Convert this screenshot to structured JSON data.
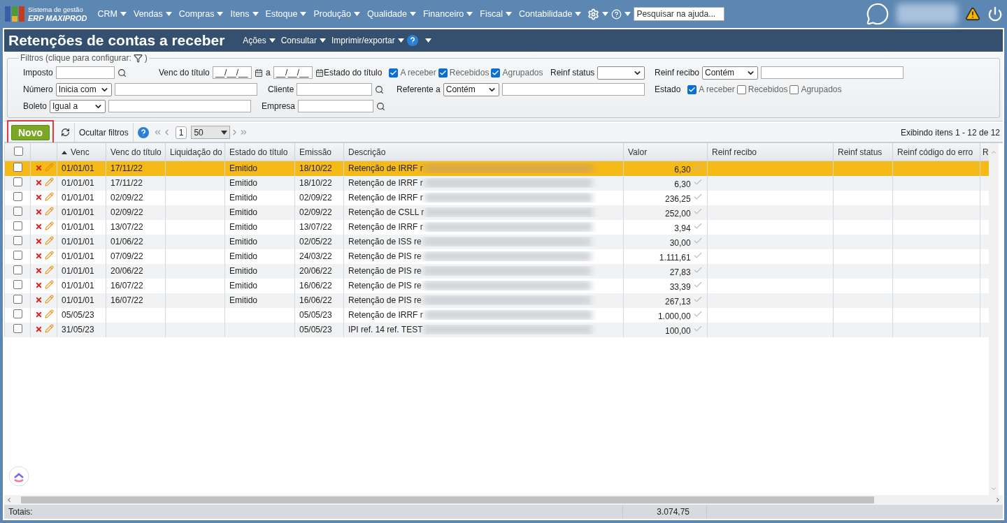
{
  "app": {
    "system_label": "Sistema de gestão",
    "product_name": "ERP MAXIPROD"
  },
  "menu": [
    {
      "label": "CRM"
    },
    {
      "label": "Vendas"
    },
    {
      "label": "Compras"
    },
    {
      "label": "Itens"
    },
    {
      "label": "Estoque"
    },
    {
      "label": "Produção"
    },
    {
      "label": "Qualidade"
    },
    {
      "label": "Financeiro"
    },
    {
      "label": "Fiscal"
    },
    {
      "label": "Contabilidade"
    }
  ],
  "help_search": {
    "placeholder": "Pesquisar na ajuda..."
  },
  "page": {
    "title": "Retenções de contas a receber",
    "actions": [
      {
        "label": "Ações"
      },
      {
        "label": "Consultar"
      },
      {
        "label": "Imprimir/exportar"
      }
    ]
  },
  "filters": {
    "legend": "Filtros (clique para configurar:",
    "legend_end": ")",
    "fields": [
      {
        "kind": "text",
        "label": "Imposto"
      },
      {
        "kind": "date_range",
        "label": "Venc do título",
        "from": "__/__/__",
        "separator": "a",
        "to": "__/__/__"
      },
      {
        "kind": "checks",
        "label": "Estado do título",
        "options": [
          {
            "label": "A receber",
            "checked": true
          },
          {
            "label": "Recebidos",
            "checked": true
          },
          {
            "label": "Agrupados",
            "checked": true
          }
        ]
      },
      {
        "kind": "select",
        "label": "Reinf status"
      },
      {
        "kind": "select_text",
        "label": "Reinf recibo",
        "operator": "Contém"
      },
      {
        "kind": "select_text",
        "label": "Número",
        "operator": "Inicia com"
      },
      {
        "kind": "text",
        "label": "Cliente"
      },
      {
        "kind": "select_text",
        "label": "Referente a",
        "operator": "Contém"
      },
      {
        "kind": "checks",
        "label": "Estado",
        "options": [
          {
            "label": "A receber",
            "checked": true
          },
          {
            "label": "Recebidos",
            "checked": false
          },
          {
            "label": "Agrupados",
            "checked": false
          }
        ]
      },
      {
        "kind": "select_text",
        "label": "Boleto",
        "operator": "Igual a"
      },
      {
        "kind": "text",
        "label": "Empresa"
      }
    ]
  },
  "toolbar": {
    "new_button": "Novo",
    "toggle_filters": "Ocultar filtros",
    "page": "1",
    "page_size": "50",
    "summary": "Exibindo itens 1 - 12 de 12"
  },
  "table": {
    "all_checked": false,
    "columns": [
      {
        "label": "Venc",
        "sorted": true
      },
      {
        "label": "Venc do título"
      },
      {
        "label": "Liquidação do"
      },
      {
        "label": "Estado do título"
      },
      {
        "label": "Emissão"
      },
      {
        "label": "Descrição"
      },
      {
        "label": "Valor"
      },
      {
        "label": "Reinf recibo"
      },
      {
        "label": "Reinf status"
      },
      {
        "label": "Reinf código do erro"
      },
      {
        "label": "R"
      }
    ],
    "rows": [
      {
        "selected": true,
        "checked": false,
        "venc": "01/01/01",
        "venc_titulo": "17/11/22",
        "estado": "Emitido",
        "emissao": "18/10/22",
        "descricao": "Retenção de IRRF r",
        "valor": "6,30"
      },
      {
        "selected": false,
        "checked": false,
        "venc": "01/01/01",
        "venc_titulo": "17/11/22",
        "estado": "Emitido",
        "emissao": "18/10/22",
        "descricao": "Retenção de IRRF r",
        "valor": "6,30"
      },
      {
        "selected": false,
        "checked": false,
        "venc": "01/01/01",
        "venc_titulo": "02/09/22",
        "estado": "Emitido",
        "emissao": "02/09/22",
        "descricao": "Retenção de IRRF r",
        "valor": "236,25"
      },
      {
        "selected": false,
        "checked": false,
        "venc": "01/01/01",
        "venc_titulo": "02/09/22",
        "estado": "Emitido",
        "emissao": "02/09/22",
        "descricao": "Retenção de CSLL r",
        "valor": "252,00"
      },
      {
        "selected": false,
        "checked": false,
        "venc": "01/01/01",
        "venc_titulo": "13/07/22",
        "estado": "Emitido",
        "emissao": "13/07/22",
        "descricao": "Retenção de IRRF r",
        "valor": "3,94"
      },
      {
        "selected": false,
        "checked": false,
        "venc": "01/01/01",
        "venc_titulo": "01/06/22",
        "estado": "Emitido",
        "emissao": "02/05/22",
        "descricao": "Retenção de ISS re",
        "valor": "30,00"
      },
      {
        "selected": false,
        "checked": false,
        "venc": "01/01/01",
        "venc_titulo": "07/09/22",
        "estado": "Emitido",
        "emissao": "24/03/22",
        "descricao": "Retenção de PIS re",
        "valor": "1.111,61"
      },
      {
        "selected": false,
        "checked": false,
        "venc": "01/01/01",
        "venc_titulo": "20/06/22",
        "estado": "Emitido",
        "emissao": "20/06/22",
        "descricao": "Retenção de PIS re",
        "valor": "27,83"
      },
      {
        "selected": false,
        "checked": false,
        "venc": "01/01/01",
        "venc_titulo": "16/07/22",
        "estado": "Emitido",
        "emissao": "16/06/22",
        "descricao": "Retenção de PIS re",
        "valor": "33,39"
      },
      {
        "selected": false,
        "checked": false,
        "venc": "01/01/01",
        "venc_titulo": "16/07/22",
        "estado": "Emitido",
        "emissao": "16/06/22",
        "descricao": "Retenção de PIS re",
        "valor": "267,13"
      },
      {
        "selected": false,
        "checked": false,
        "venc": "05/05/23",
        "emissao": "05/05/23",
        "descricao": "Retenção de IRRF r",
        "valor": "1.000,00"
      },
      {
        "selected": false,
        "checked": false,
        "venc": "31/05/23",
        "emissao": "05/05/23",
        "descricao": "IPI ref. 14 ref. TEST",
        "valor": "100,00"
      }
    ]
  },
  "totals": {
    "label": "Totais:",
    "valor": "3.074,75"
  }
}
